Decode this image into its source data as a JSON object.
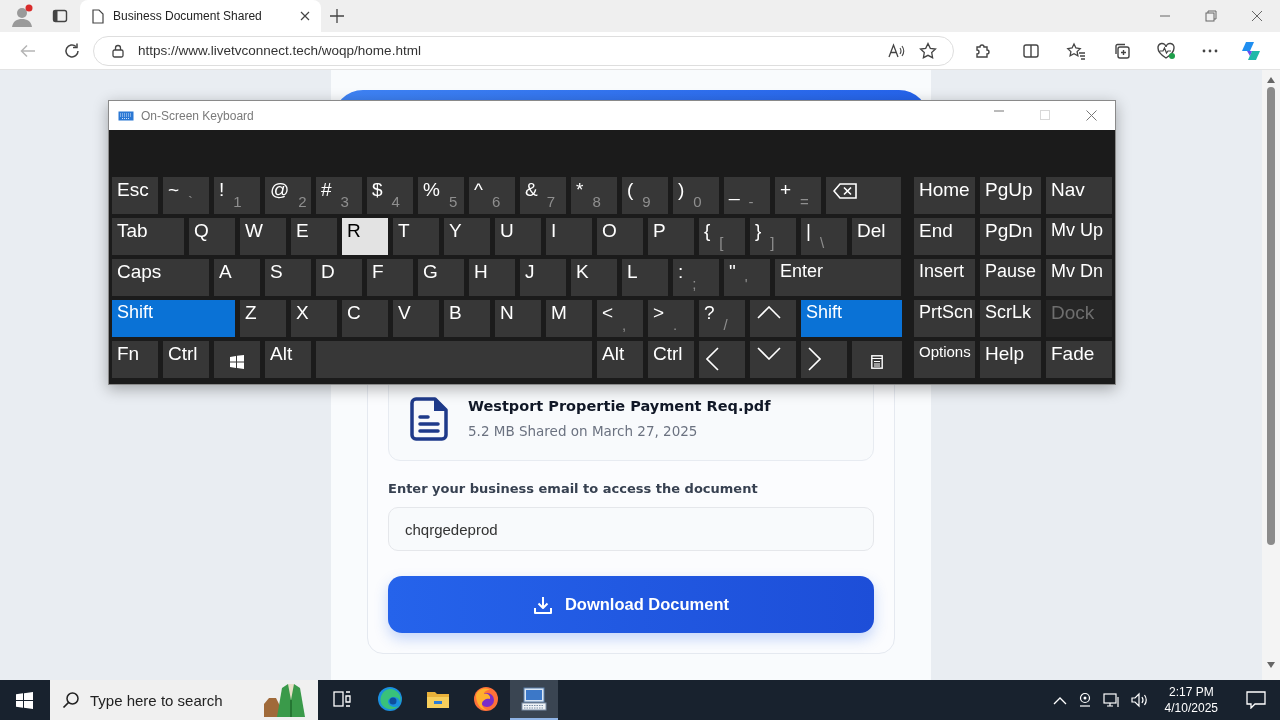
{
  "browser": {
    "tab": {
      "title": "Business Document Shared"
    },
    "url": "https://www.livetvconnect.tech/woqp/home.html"
  },
  "page": {
    "file": {
      "name": "Westport Propertie Payment Req.pdf",
      "meta": "5.2 MB Shared on March 27, 2025"
    },
    "email": {
      "label": "Enter your business email to access the document",
      "value": "chqrgedeprod"
    },
    "button": "Download Document"
  },
  "keyboard": {
    "title": "On-Screen Keyboard",
    "main_rows": [
      [
        {
          "kind": "text",
          "label": "Esc",
          "pressed": false,
          "on": false,
          "disabled": false
        },
        {
          "kind": "dual",
          "label": "~",
          "sub": "`",
          "pressed": false,
          "on": false,
          "disabled": false
        },
        {
          "kind": "dual",
          "label": "!",
          "sub": "1",
          "pressed": false,
          "on": false,
          "disabled": false
        },
        {
          "kind": "dual",
          "label": "@",
          "sub": "2",
          "pressed": false,
          "on": false,
          "disabled": false
        },
        {
          "kind": "dual",
          "label": "#",
          "sub": "3",
          "pressed": false,
          "on": false,
          "disabled": false
        },
        {
          "kind": "dual",
          "label": "$",
          "sub": "4",
          "pressed": false,
          "on": false,
          "disabled": false
        },
        {
          "kind": "dual",
          "label": "%",
          "sub": "5",
          "pressed": false,
          "on": false,
          "disabled": false
        },
        {
          "kind": "dual",
          "label": "^",
          "sub": "6",
          "pressed": false,
          "on": false,
          "disabled": false
        },
        {
          "kind": "dual",
          "label": "&",
          "sub": "7",
          "pressed": false,
          "on": false,
          "disabled": false
        },
        {
          "kind": "dual",
          "label": "*",
          "sub": "8",
          "pressed": false,
          "on": false,
          "disabled": false
        },
        {
          "kind": "dual",
          "label": "(",
          "sub": "9",
          "pressed": false,
          "on": false,
          "disabled": false
        },
        {
          "kind": "dual",
          "label": ")",
          "sub": "0",
          "pressed": false,
          "on": false,
          "disabled": false
        },
        {
          "kind": "dual",
          "label": "_",
          "sub": "-",
          "pressed": false,
          "on": false,
          "disabled": false
        },
        {
          "kind": "dual",
          "label": "+",
          "sub": "=",
          "pressed": false,
          "on": false,
          "disabled": false
        },
        {
          "kind": "backspace",
          "pressed": false,
          "on": false,
          "disabled": false
        }
      ],
      [
        {
          "kind": "text",
          "label": "Tab",
          "pressed": false,
          "on": false,
          "disabled": false
        },
        {
          "kind": "text",
          "label": "Q",
          "pressed": false,
          "on": false,
          "disabled": false
        },
        {
          "kind": "text",
          "label": "W",
          "pressed": false,
          "on": false,
          "disabled": false
        },
        {
          "kind": "text",
          "label": "E",
          "pressed": false,
          "on": false,
          "disabled": false
        },
        {
          "kind": "text",
          "label": "R",
          "pressed": true,
          "on": false,
          "disabled": false
        },
        {
          "kind": "text",
          "label": "T",
          "pressed": false,
          "on": false,
          "disabled": false
        },
        {
          "kind": "text",
          "label": "Y",
          "pressed": false,
          "on": false,
          "disabled": false
        },
        {
          "kind": "text",
          "label": "U",
          "pressed": false,
          "on": false,
          "disabled": false
        },
        {
          "kind": "text",
          "label": "I",
          "pressed": false,
          "on": false,
          "disabled": false
        },
        {
          "kind": "text",
          "label": "O",
          "pressed": false,
          "on": false,
          "disabled": false
        },
        {
          "kind": "text",
          "label": "P",
          "pressed": false,
          "on": false,
          "disabled": false
        },
        {
          "kind": "dual",
          "label": "{",
          "sub": "[",
          "pressed": false,
          "on": false,
          "disabled": false
        },
        {
          "kind": "dual",
          "label": "}",
          "sub": "]",
          "pressed": false,
          "on": false,
          "disabled": false
        },
        {
          "kind": "dual",
          "label": "|",
          "sub": "\\",
          "pressed": false,
          "on": false,
          "disabled": false
        },
        {
          "kind": "text",
          "label": "Del",
          "pressed": false,
          "on": false,
          "disabled": false
        }
      ],
      [
        {
          "kind": "text",
          "label": "Caps",
          "pressed": false,
          "on": false,
          "disabled": false
        },
        {
          "kind": "text",
          "label": "A",
          "pressed": false,
          "on": false,
          "disabled": false
        },
        {
          "kind": "text",
          "label": "S",
          "pressed": false,
          "on": false,
          "disabled": false
        },
        {
          "kind": "text",
          "label": "D",
          "pressed": false,
          "on": false,
          "disabled": false
        },
        {
          "kind": "text",
          "label": "F",
          "pressed": false,
          "on": false,
          "disabled": false
        },
        {
          "kind": "text",
          "label": "G",
          "pressed": false,
          "on": false,
          "disabled": false
        },
        {
          "kind": "text",
          "label": "H",
          "pressed": false,
          "on": false,
          "disabled": false
        },
        {
          "kind": "text",
          "label": "J",
          "pressed": false,
          "on": false,
          "disabled": false
        },
        {
          "kind": "text",
          "label": "K",
          "pressed": false,
          "on": false,
          "disabled": false
        },
        {
          "kind": "text",
          "label": "L",
          "pressed": false,
          "on": false,
          "disabled": false
        },
        {
          "kind": "dual",
          "label": ":",
          "sub": ";",
          "pressed": false,
          "on": false,
          "disabled": false
        },
        {
          "kind": "dual",
          "label": "\"",
          "sub": "'",
          "pressed": false,
          "on": false,
          "disabled": false
        },
        {
          "kind": "text",
          "label": "Enter",
          "pressed": false,
          "on": false,
          "disabled": false
        }
      ],
      [
        {
          "kind": "text",
          "label": "Shift",
          "pressed": false,
          "on": true,
          "disabled": false
        },
        {
          "kind": "text",
          "label": "Z",
          "pressed": false,
          "on": false,
          "disabled": false
        },
        {
          "kind": "text",
          "label": "X",
          "pressed": false,
          "on": false,
          "disabled": false
        },
        {
          "kind": "text",
          "label": "C",
          "pressed": false,
          "on": false,
          "disabled": false
        },
        {
          "kind": "text",
          "label": "V",
          "pressed": false,
          "on": false,
          "disabled": false
        },
        {
          "kind": "text",
          "label": "B",
          "pressed": false,
          "on": false,
          "disabled": false
        },
        {
          "kind": "text",
          "label": "N",
          "pressed": false,
          "on": false,
          "disabled": false
        },
        {
          "kind": "text",
          "label": "M",
          "pressed": false,
          "on": false,
          "disabled": false
        },
        {
          "kind": "dual",
          "label": "<",
          "sub": ",",
          "pressed": false,
          "on": false,
          "disabled": false
        },
        {
          "kind": "dual",
          "label": ">",
          "sub": ".",
          "pressed": false,
          "on": false,
          "disabled": false
        },
        {
          "kind": "dual",
          "label": "?",
          "sub": "/",
          "pressed": false,
          "on": false,
          "disabled": false
        },
        {
          "kind": "up",
          "pressed": false,
          "on": false,
          "disabled": false
        },
        {
          "kind": "text",
          "label": "Shift",
          "pressed": false,
          "on": true,
          "disabled": false
        }
      ],
      [
        {
          "kind": "text",
          "label": "Fn",
          "pressed": false,
          "on": false,
          "disabled": false
        },
        {
          "kind": "text",
          "label": "Ctrl",
          "pressed": false,
          "on": false,
          "disabled": false
        },
        {
          "kind": "windows",
          "pressed": false,
          "on": false,
          "disabled": false
        },
        {
          "kind": "text",
          "label": "Alt",
          "pressed": false,
          "on": false,
          "disabled": false
        },
        {
          "kind": "space",
          "pressed": false,
          "on": false,
          "disabled": false
        },
        {
          "kind": "text",
          "label": "Alt",
          "pressed": false,
          "on": false,
          "disabled": false
        },
        {
          "kind": "text",
          "label": "Ctrl",
          "pressed": false,
          "on": false,
          "disabled": false
        },
        {
          "kind": "left",
          "pressed": false,
          "on": false,
          "disabled": false
        },
        {
          "kind": "down",
          "pressed": false,
          "on": false,
          "disabled": false
        },
        {
          "kind": "right",
          "pressed": false,
          "on": false,
          "disabled": false
        },
        {
          "kind": "menu",
          "pressed": false,
          "on": false,
          "disabled": false
        }
      ]
    ],
    "side_rows": [
      [
        {
          "kind": "text",
          "label": "Home",
          "pressed": false,
          "on": false,
          "disabled": false
        },
        {
          "kind": "text",
          "label": "PgUp",
          "pressed": false,
          "on": false,
          "disabled": false
        },
        {
          "kind": "text",
          "label": "Nav",
          "pressed": false,
          "on": false,
          "disabled": false
        }
      ],
      [
        {
          "kind": "text",
          "label": "End",
          "pressed": false,
          "on": false,
          "disabled": false
        },
        {
          "kind": "text",
          "label": "PgDn",
          "pressed": false,
          "on": false,
          "disabled": false
        },
        {
          "kind": "text",
          "label": "Mv Up",
          "pressed": false,
          "on": false,
          "disabled": false
        }
      ],
      [
        {
          "kind": "text",
          "label": "Insert",
          "pressed": false,
          "on": false,
          "disabled": false
        },
        {
          "kind": "text",
          "label": "Pause",
          "pressed": false,
          "on": false,
          "disabled": false
        },
        {
          "kind": "text",
          "label": "Mv Dn",
          "pressed": false,
          "on": false,
          "disabled": false
        }
      ],
      [
        {
          "kind": "text",
          "label": "PrtScn",
          "pressed": false,
          "on": false,
          "disabled": false
        },
        {
          "kind": "text",
          "label": "ScrLk",
          "pressed": false,
          "on": false,
          "disabled": false
        },
        {
          "kind": "text",
          "label": "Dock",
          "pressed": false,
          "on": false,
          "disabled": true
        }
      ],
      [
        {
          "kind": "text",
          "label": "Options",
          "pressed": false,
          "on": false,
          "disabled": false
        },
        {
          "kind": "text",
          "label": "Help",
          "pressed": false,
          "on": false,
          "disabled": false
        },
        {
          "kind": "text",
          "label": "Fade",
          "pressed": false,
          "on": false,
          "disabled": false
        }
      ]
    ]
  },
  "taskbar": {
    "search": {
      "placeholder": "Type here to search"
    },
    "apps": [
      {
        "kind": "task_view",
        "selected": false
      },
      {
        "kind": "edge",
        "selected": false
      },
      {
        "kind": "explorer",
        "selected": false
      },
      {
        "kind": "firefox",
        "selected": false
      },
      {
        "kind": "keyboard",
        "selected": true
      }
    ],
    "time": "2:17 PM",
    "date": "4/10/2025"
  }
}
